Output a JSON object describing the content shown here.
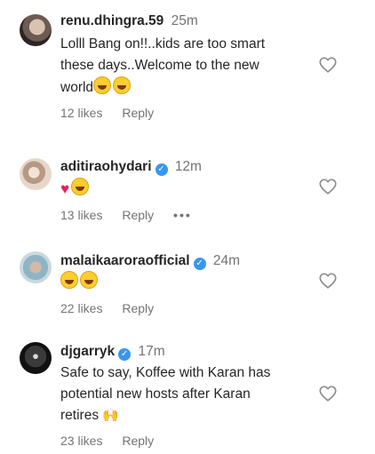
{
  "comments": [
    {
      "username": "renu.dhingra.59",
      "verified": false,
      "time": "25m",
      "text_lines": [
        "Lolll Bang on!!..kids are too smart",
        "these days..Welcome to the new",
        "world"
      ],
      "emojis": [
        "grinning-sweat-emoji",
        "grinning-sweat-emoji"
      ],
      "likes": "12 likes",
      "reply": "Reply"
    },
    {
      "username": "aditiraohydari",
      "verified": true,
      "time": "12m",
      "emojis": [
        "red-heart-emoji",
        "grinning-sweat-emoji"
      ],
      "likes": "13 likes",
      "reply": "Reply",
      "more": "•••"
    },
    {
      "username": "malaikaaroraofficial",
      "verified": true,
      "time": "24m",
      "emojis": [
        "grinning-sweat-emoji",
        "grinning-sweat-emoji"
      ],
      "likes": "22 likes",
      "reply": "Reply"
    },
    {
      "username": "djgarryk",
      "verified": true,
      "time": "17m",
      "text_lines": [
        "Safe to say, Koffee with Karan has",
        "potential new hosts after Karan",
        "retires"
      ],
      "emojis": [
        "raising-hands-emoji"
      ],
      "likes": "23 likes",
      "reply": "Reply"
    }
  ]
}
